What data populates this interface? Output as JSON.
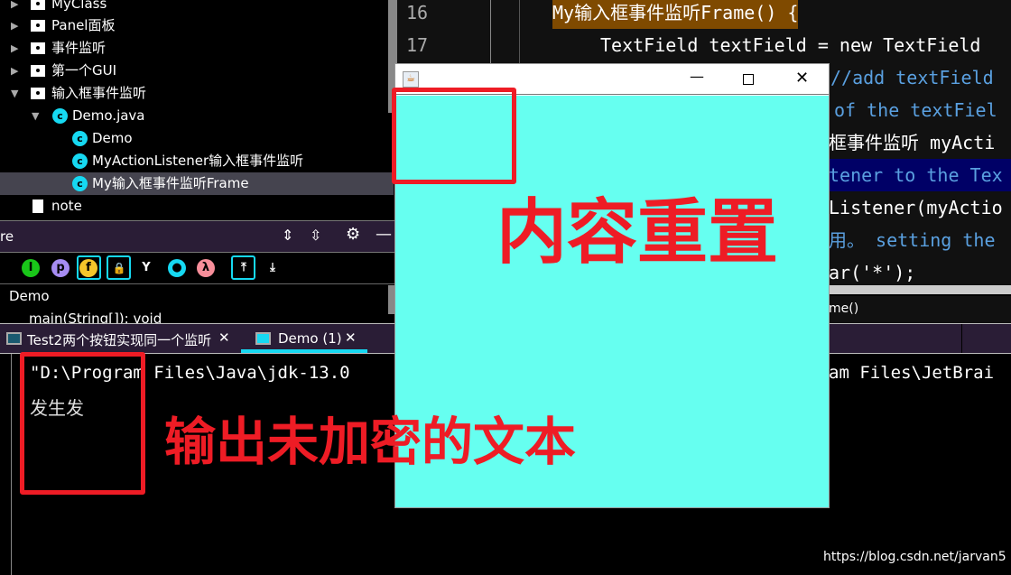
{
  "project_tree": {
    "items": [
      {
        "label": "MyClass",
        "type": "folder",
        "expanded": false
      },
      {
        "label": "Panel面板",
        "type": "folder",
        "expanded": false
      },
      {
        "label": "事件监听",
        "type": "folder",
        "expanded": false
      },
      {
        "label": "第一个GUI",
        "type": "folder",
        "expanded": false
      },
      {
        "label": "输入框事件监听",
        "type": "folder",
        "expanded": true
      },
      {
        "label": "Demo.java",
        "type": "class-file",
        "expanded": true
      },
      {
        "label": "Demo",
        "type": "class"
      },
      {
        "label": "MyActionListener输入框事件监听",
        "type": "class"
      },
      {
        "label": "My输入框事件监听Frame",
        "type": "class",
        "selected": true
      },
      {
        "label": "note",
        "type": "file"
      }
    ]
  },
  "structure": {
    "title": "re",
    "root": "Demo",
    "member": "main(String[]): void",
    "filter_icons": [
      "inherited-icon",
      "property-icon",
      "field-icon",
      "lock-icon",
      "fork-icon",
      "anonymous-icon",
      "lambda-icon",
      "autoscroll-to-source-icon",
      "autoscroll-from-source-icon"
    ]
  },
  "editor": {
    "lines": [
      {
        "num": "16",
        "text": "My输入框事件监听Frame() {"
      },
      {
        "num": "17",
        "text": "TextField textField = new TextField"
      },
      {
        "text": "//add textField"
      },
      {
        "text": "of the textFiel"
      },
      {
        "text": "框事件监听 myActi"
      },
      {
        "text": "tener to the Tex"
      },
      {
        "text": "Listener(myActio"
      },
      {
        "text": "用。 setting the"
      },
      {
        "text": "ar('*');"
      }
    ],
    "breadcrumb": "me()"
  },
  "run": {
    "tabs": [
      {
        "label": "Test2两个按钮实现同一个监听",
        "active": false
      },
      {
        "label": "Demo (1)",
        "active": true
      }
    ],
    "console": [
      "\"D:\\Program Files\\Java\\jdk-13.0",
      "am Files\\JetBrai",
      "发生发"
    ]
  },
  "java_window": {
    "bg": "#66fff0"
  },
  "annotations": {
    "content_reset": "内容重置",
    "output_plain": "输出未加密的文本",
    "color": "#ee1c25"
  },
  "watermark": "https://blog.csdn.net/jarvan5"
}
